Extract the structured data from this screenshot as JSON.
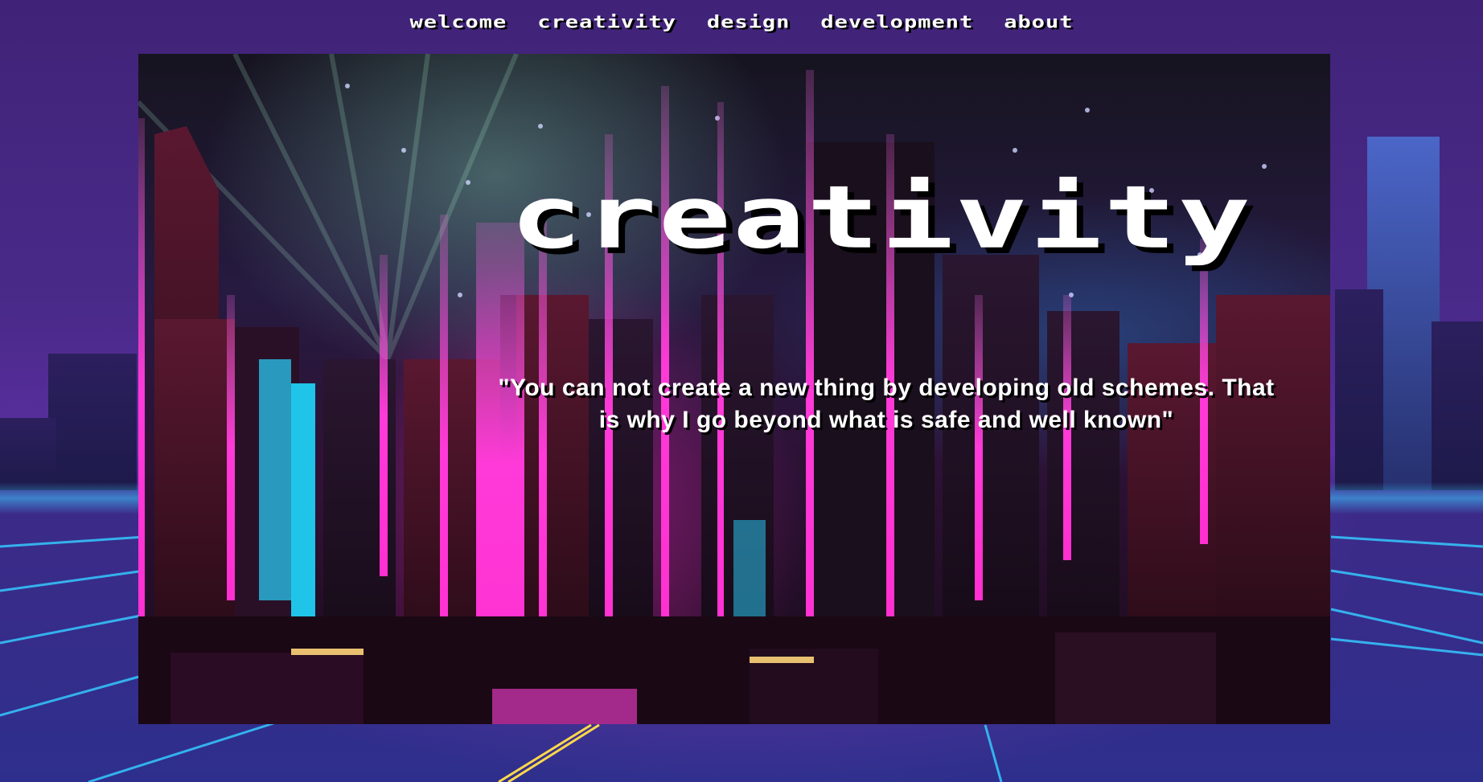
{
  "nav": {
    "items": [
      {
        "label": "welcome"
      },
      {
        "label": "creativity"
      },
      {
        "label": "design"
      },
      {
        "label": "development"
      },
      {
        "label": "about"
      }
    ]
  },
  "hero": {
    "title": "creativity",
    "quote": "\"You can not create a new thing by developing old schemes. That is why I go beyond what is safe and well known\""
  },
  "colors": {
    "page_background": "#3a2470",
    "neon_pink": "#ff2fd6",
    "neon_cyan": "#3fd8ff",
    "text": "#ffffff"
  }
}
